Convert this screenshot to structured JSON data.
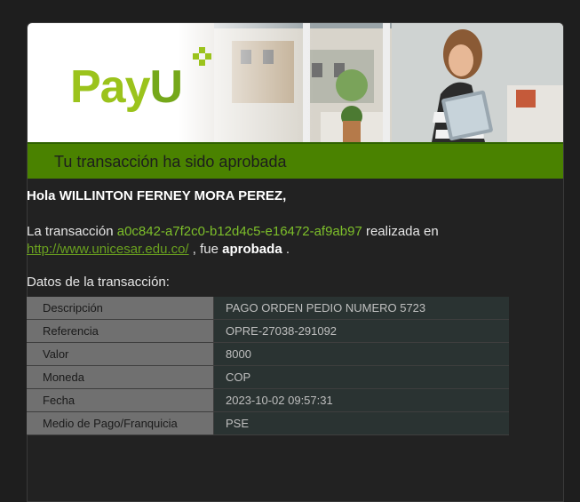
{
  "logo": {
    "text_pay": "Pay",
    "text_u": "U"
  },
  "header": {
    "title": "Tu transacción ha sido aprobada"
  },
  "greeting": {
    "prefix": "Hola",
    "name": "WILLINTON FERNEY MORA PEREZ,"
  },
  "message": {
    "part1": "La transacción",
    "transaction_id": "a0c842-a7f2c0-b12d4c5-e16472-af9ab97",
    "part2": "realizada en",
    "link": "http://www.unicesar.edu.co/",
    "part3": ", fue",
    "status": "aprobada",
    "part4": "."
  },
  "details": {
    "label": "Datos de la transacción:",
    "rows": [
      {
        "key": "Descripción",
        "value": "PAGO ORDEN PEDIO NUMERO  5723"
      },
      {
        "key": "Referencia",
        "value": "OPRE-27038-291092"
      },
      {
        "key": "Valor",
        "value": "8000"
      },
      {
        "key": "Moneda",
        "value": "COP"
      },
      {
        "key": "Fecha",
        "value": "2023-10-02 09:57:31"
      },
      {
        "key": "Medio de Pago/Franquicia",
        "value": "PSE"
      }
    ]
  },
  "colors": {
    "brand_green": "#9bc31c",
    "header_green": "#4a8200",
    "link_green": "#6aa11f"
  }
}
